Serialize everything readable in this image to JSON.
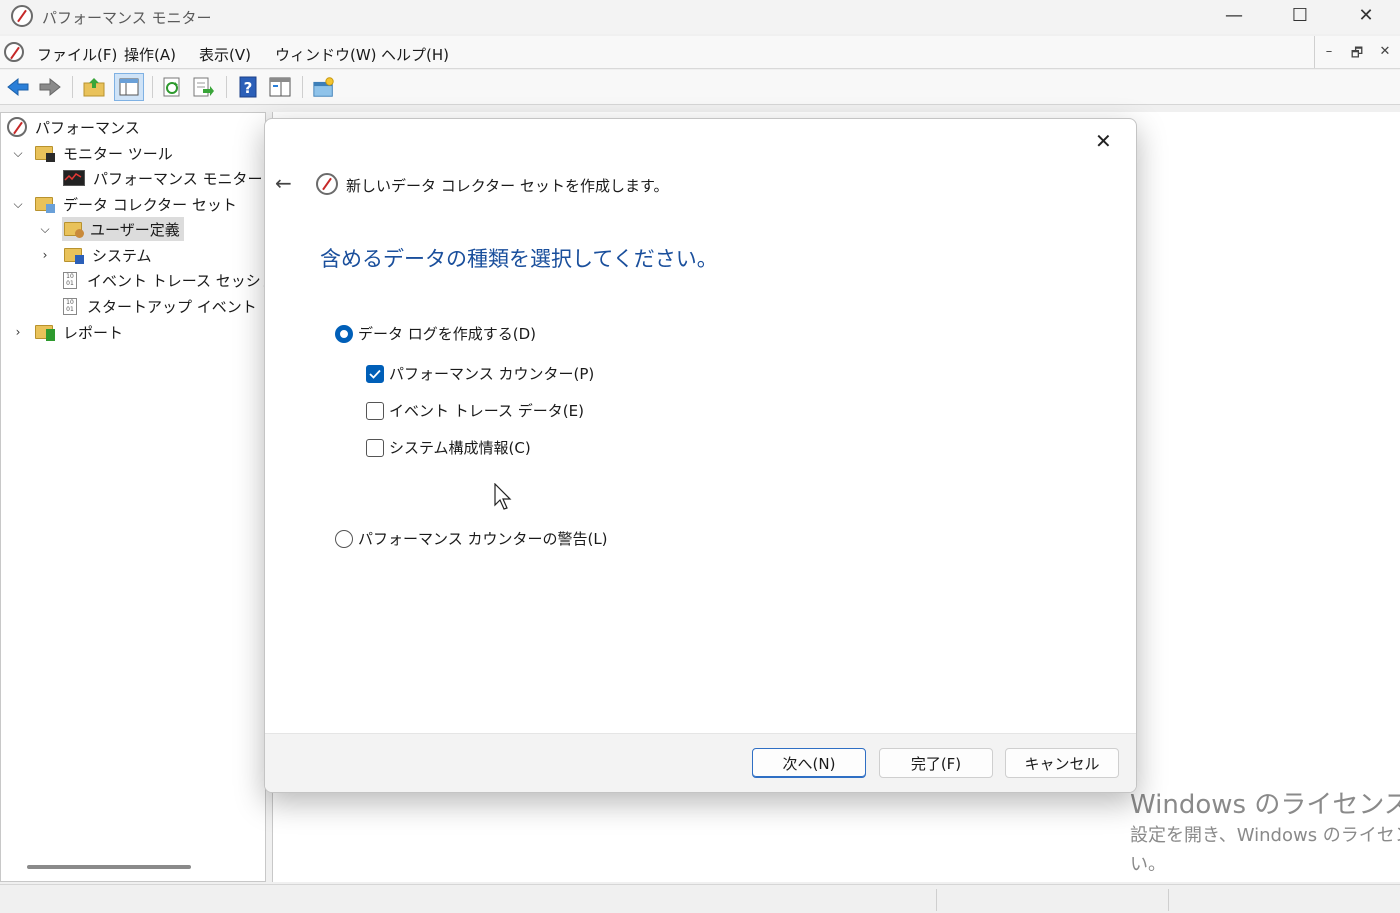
{
  "window": {
    "title": "パフォーマンス モニター",
    "controls": {
      "minimize": "—",
      "maximize": "☐",
      "close": "✕"
    }
  },
  "menubar": {
    "items": [
      "ファイル(F)",
      "操作(A)",
      "表示(V)",
      "ウィンドウ(W)",
      "ヘルプ(H)"
    ],
    "mdi": {
      "minimize": "–",
      "restore": "🗗",
      "close": "✕"
    }
  },
  "tree": {
    "root": "パフォーマンス",
    "monitor_tools": "モニター ツール",
    "perf_monitor": "パフォーマンス モニター",
    "data_collector_sets": "データ コレクター セット",
    "user_defined": "ユーザー定義",
    "system": "システム",
    "event_trace": "イベント トレース セッション",
    "startup_trace": "スタートアップ イベント トレース",
    "reports": "レポート"
  },
  "dialog": {
    "header": "新しいデータ コレクター セットを作成します。",
    "heading": "含めるデータの種類を選択してください。",
    "radio_create_log": "データ ログを作成する(D)",
    "check_perf_counter": "パフォーマンス カウンター(P)",
    "check_event_trace": "イベント トレース データ(E)",
    "check_sys_config": "システム構成情報(C)",
    "radio_alert": "パフォーマンス カウンターの警告(L)",
    "next_button": "次へ(N)",
    "finish_button": "完了(F)",
    "cancel_button": "キャンセル",
    "close": "✕",
    "back": "←"
  },
  "state": {
    "create_log_selected": true,
    "perf_counter_checked": true,
    "event_trace_checked": false,
    "sys_config_checked": false,
    "alert_selected": false
  },
  "watermark": {
    "line1": "Windows のライセンス認",
    "line2": "設定を開き、Windows のライセン",
    "line3": "い。"
  }
}
